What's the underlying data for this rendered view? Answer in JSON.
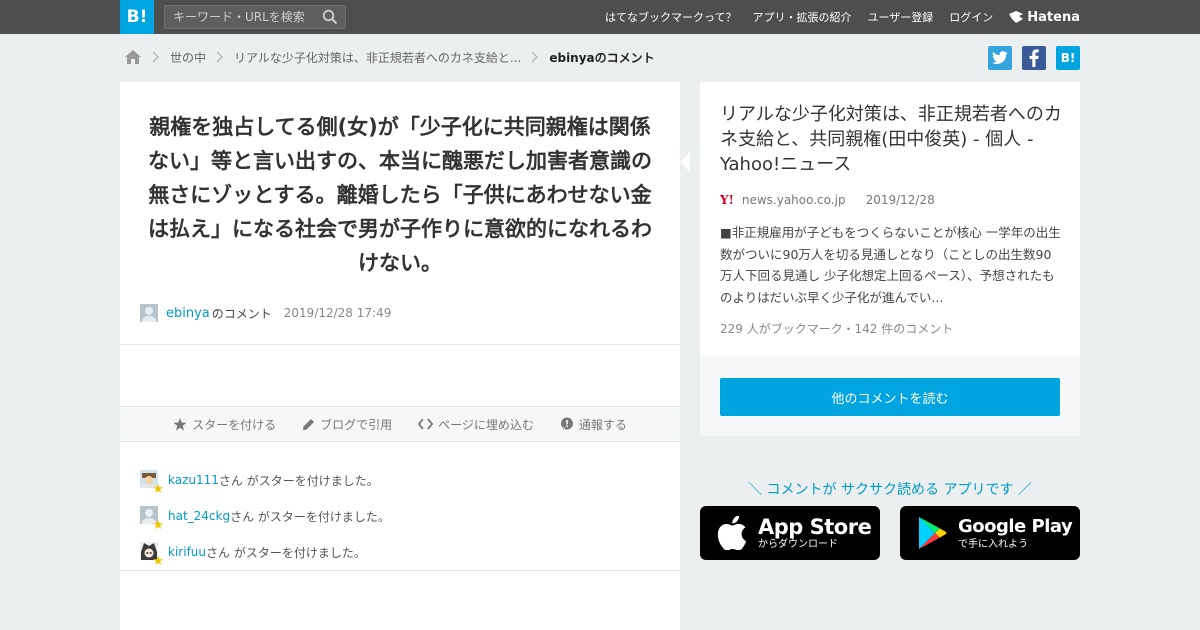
{
  "header": {
    "logo": "B!",
    "search_placeholder": "キーワード・URLを検索",
    "nav": [
      "はてなブックマークって？",
      "アプリ・拡張の紹介",
      "ユーザー登録",
      "ログイン"
    ],
    "brand": "Hatena"
  },
  "breadcrumb": {
    "items": [
      "世の中",
      "リアルな少子化対策は、非正規若者へのカネ支給と...",
      "ebinyaのコメント"
    ]
  },
  "share": {
    "hatena_label": "B!"
  },
  "comment": {
    "text": "親権を独占してる側(女)が「少子化に共同親権は関係ない」等と言い出すの、本当に醜悪だし加害者意識の無さにゾッとする。離婚したら「子供にあわせない金は払え」になる社会で男が子作りに意欲的になれるわけない。",
    "user": "ebinya",
    "suffix": "のコメント",
    "timestamp": "2019/12/28 17:49"
  },
  "actions": [
    "スターを付ける",
    "ブログで引用",
    "ページに埋め込む",
    "通報する"
  ],
  "stars": [
    {
      "user": "kazu111",
      "text": "さん がスターを付けました。"
    },
    {
      "user": "hat_24ckg",
      "text": "さん がスターを付けました。"
    },
    {
      "user": "kirifuu",
      "text": "さん がスターを付けました。"
    }
  ],
  "article": {
    "title": "リアルな少子化対策は、非正規若者へのカネ支給と、共同親権(田中俊英) - 個人 - Yahoo!ニュース",
    "source_icon": "Y!",
    "domain": "news.yahoo.co.jp",
    "date": "2019/12/28",
    "summary": "■非正規雇用が子どもをつくらないことが核心 一学年の出生数がついに90万人を切る見通しとなり（ことしの出生数90万人下回る見通し 少子化想定上回るペース）、予想されたものよりはだいぶ早く少子化が進んでい...",
    "meta": "229 人がブックマーク・142 件のコメント",
    "read_button": "他のコメントを読む"
  },
  "promo": {
    "text": "＼ コメントが サクサク読める アプリです ／",
    "app_store_name": "App Store",
    "app_store_sub": "からダウンロード",
    "google_play_name": "Google Play",
    "google_play_sub": "で手に入れよう"
  },
  "colors": {
    "accent": "#00a4de",
    "link": "#009ac6",
    "topbar": "#4e4e4e",
    "twitter": "#33a5dc",
    "facebook": "#3a5b98",
    "star": "#f2c600"
  }
}
